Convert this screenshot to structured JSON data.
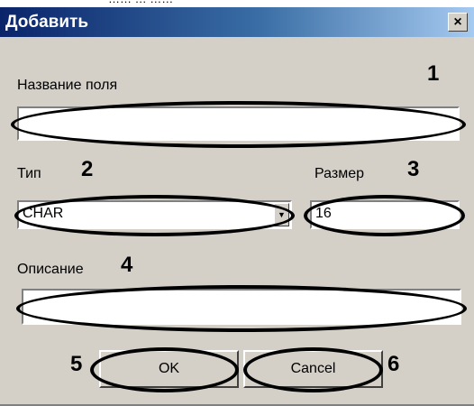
{
  "caption_fragment": "……                 …           ……",
  "dialog": {
    "title": "Добавить",
    "close_glyph": "×"
  },
  "fields": {
    "name_label": "Название поля",
    "name_value": "",
    "type_label": "Тип",
    "type_value": "CHAR",
    "size_label": "Размер",
    "size_value": "16",
    "description_label": "Описание",
    "description_value": ""
  },
  "markers": {
    "m1": "1",
    "m2": "2",
    "m3": "3",
    "m4": "4",
    "m5": "5",
    "m6": "6"
  },
  "buttons": {
    "ok": "OK",
    "cancel": "Cancel"
  },
  "icons": {
    "close": "close-icon",
    "dropdown": "chevron-down-icon"
  }
}
